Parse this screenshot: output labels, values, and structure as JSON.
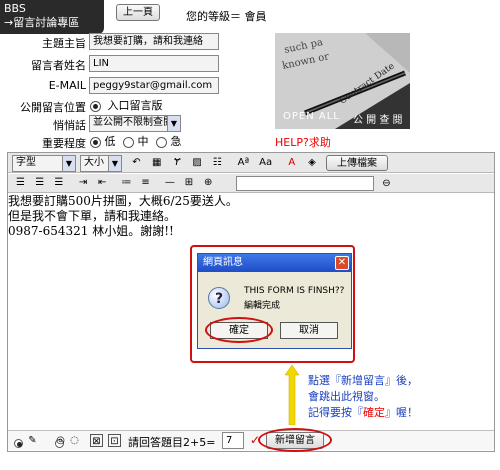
{
  "header": {
    "badge_line1": "BBS",
    "badge_line2": "→留言討論專區",
    "prev_button": "上一頁",
    "level_text": "您的等級＝ 會員"
  },
  "form": {
    "subject_label": "主題主旨",
    "subject_value": "我想要訂購，請和我連絡",
    "name_label": "留言者姓名",
    "name_value": "LIN",
    "email_label": "E-MAIL",
    "email_value": "peggy9star@gmail.com",
    "public_label": "公開留言位置",
    "public_option": "入口留言版",
    "whisper_label": "悄悄話",
    "whisper_value": "並公開不限制查閱",
    "importance_label": "重要程度",
    "importance_options": [
      "低",
      "中",
      "急"
    ],
    "photo_caption_left": "OPEN ALL",
    "photo_caption_right": "公 開 查 閱",
    "photo_text": "Contract Date",
    "help_text": "HELP?求助"
  },
  "toolbar": {
    "font_select": "字型",
    "size_select": "大小",
    "upload_button": "上傳檔案"
  },
  "message": {
    "lines": [
      "我想要訂購500片拼圖，大概6/25要送人。",
      "但是我不會下單，請和我連絡。",
      "0987-654321 林小姐。謝謝!!"
    ]
  },
  "dialog": {
    "title": "網頁訊息",
    "line1": "THIS FORM IS FINSH??",
    "line2": "編輯完成",
    "ok_button": "確定",
    "cancel_button": "取消"
  },
  "annotation": {
    "line1": "點選『新增留言』後，",
    "line2": "會跳出此視窗。",
    "line3_pre": "記得要按『",
    "line3_red": "確定",
    "line3_post": "』喔！"
  },
  "bottom": {
    "captcha_text": "請回答題目2+5=",
    "captcha_answer": "7",
    "submit_button": "新增留言"
  },
  "colors": {
    "accent_red": "#d01010",
    "annotation_blue": "#1a40c0",
    "arrow_yellow": "#f2d600"
  }
}
